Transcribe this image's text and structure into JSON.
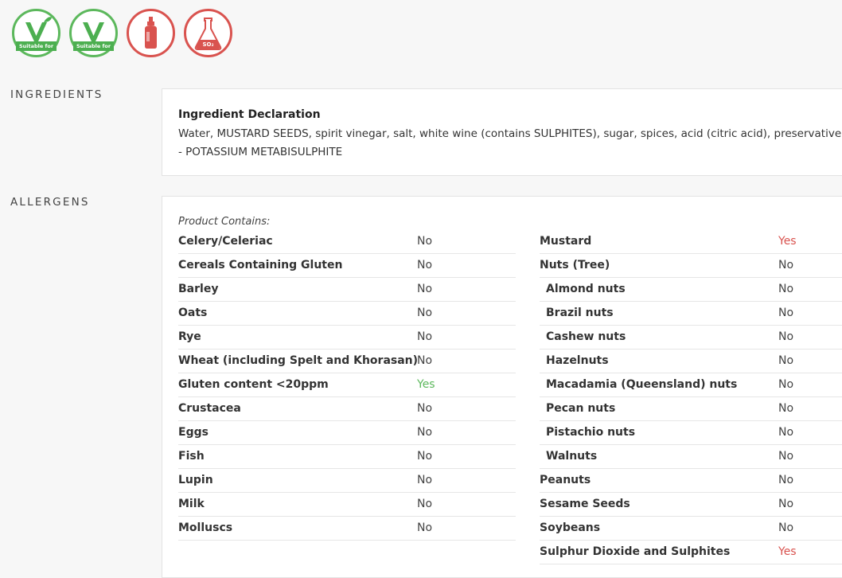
{
  "badges": [
    {
      "icon": "vegan-icon",
      "label": "Suitable for",
      "color": "#5cb85c"
    },
    {
      "icon": "vegetarian-icon",
      "label": "Suitable for",
      "color": "#5cb85c"
    },
    {
      "icon": "sauce-bottle-icon",
      "color": "#d9534f"
    },
    {
      "icon": "flask-icon",
      "label": "SO₂",
      "color": "#d9534f"
    }
  ],
  "sections": {
    "ingredients_label": "INGREDIENTS",
    "allergens_label": "ALLERGENS"
  },
  "ingredients": {
    "title": "Ingredient Declaration",
    "text": "Water, MUSTARD SEEDS, spirit vinegar, salt, white wine (contains SULPHITES), sugar, spices, acid (citric acid), preservative - POTASSIUM METABISULPHITE"
  },
  "allergens": {
    "contains_label": "Product Contains:",
    "left": [
      {
        "name": "Celery/Celeriac",
        "value": "No"
      },
      {
        "name": "Cereals Containing Gluten",
        "value": "No"
      },
      {
        "name": "Barley",
        "value": "No"
      },
      {
        "name": "Oats",
        "value": "No"
      },
      {
        "name": "Rye",
        "value": "No"
      },
      {
        "name": "Wheat (including Spelt and Khorasan)",
        "value": "No"
      },
      {
        "name": "Gluten content <20ppm",
        "value": "Yes"
      },
      {
        "name": "Crustacea",
        "value": "No"
      },
      {
        "name": "Eggs",
        "value": "No"
      },
      {
        "name": "Fish",
        "value": "No"
      },
      {
        "name": "Lupin",
        "value": "No"
      },
      {
        "name": "Milk",
        "value": "No"
      },
      {
        "name": "Molluscs",
        "value": "No"
      }
    ],
    "right": [
      {
        "name": "Mustard",
        "value": "Yes"
      },
      {
        "name": "Nuts (Tree)",
        "value": "No"
      },
      {
        "name": "Almond nuts",
        "value": "No"
      },
      {
        "name": "Brazil nuts",
        "value": "No"
      },
      {
        "name": "Cashew nuts",
        "value": "No"
      },
      {
        "name": "Hazelnuts",
        "value": "No"
      },
      {
        "name": "Macadamia (Queensland) nuts",
        "value": "No"
      },
      {
        "name": "Pecan nuts",
        "value": "No"
      },
      {
        "name": "Pistachio nuts",
        "value": "No"
      },
      {
        "name": "Walnuts",
        "value": "No"
      },
      {
        "name": "Peanuts",
        "value": "No"
      },
      {
        "name": "Sesame Seeds",
        "value": "No"
      },
      {
        "name": "Soybeans",
        "value": "No"
      },
      {
        "name": "Sulphur Dioxide and Sulphites",
        "value": "Yes"
      }
    ]
  },
  "colors": {
    "yes_positive": "#5cb85c",
    "yes_negative": "#d9534f"
  }
}
